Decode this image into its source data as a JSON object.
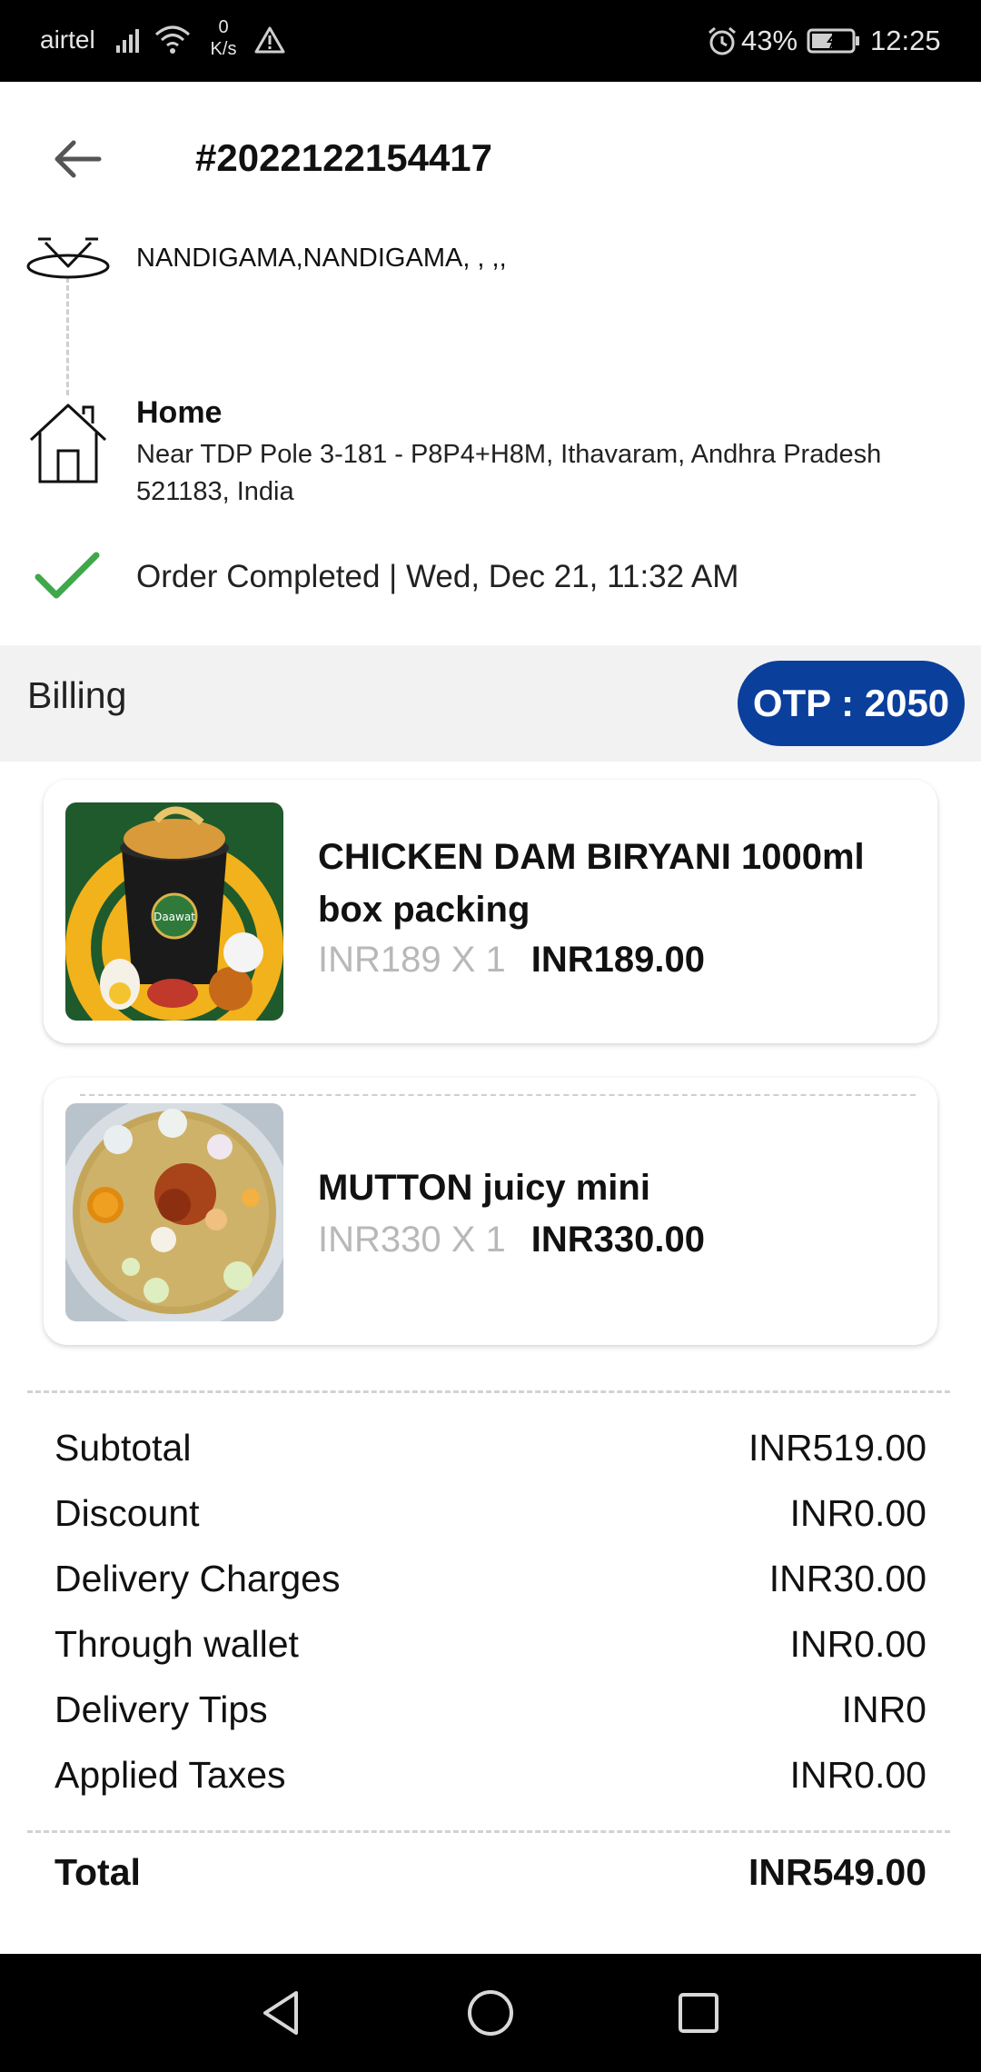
{
  "status_bar": {
    "carrier": "airtel",
    "speed_value": "0",
    "speed_unit": "K/s",
    "battery": "43%",
    "time": "12:25"
  },
  "header": {
    "order_id": "#2022122154417"
  },
  "route": {
    "pickup_address": "NANDIGAMA,NANDIGAMA, , ,,",
    "drop_label": "Home",
    "drop_address": "Near TDP Pole 3-181 - P8P4+H8M, Ithavaram, Andhra Pradesh 521183, India",
    "status": "Order Completed | Wed, Dec 21, 11:32 AM"
  },
  "billing": {
    "title": "Billing",
    "otp": "OTP : 2050"
  },
  "items": [
    {
      "name": "CHICKEN DAM BIRYANI 1000ml box packing",
      "unit": "INR189 X 1",
      "total": "INR189.00",
      "image_brand": "Daawat"
    },
    {
      "name": "MUTTON juicy mini",
      "unit": "INR330 X 1",
      "total": "INR330.00"
    }
  ],
  "summary": {
    "subtotal_label": "Subtotal",
    "subtotal_value": "INR519.00",
    "discount_label": "Discount",
    "discount_value": "INR0.00",
    "delivery_label": "Delivery Charges",
    "delivery_value": "INR30.00",
    "wallet_label": "Through wallet",
    "wallet_value": "INR0.00",
    "tips_label": "Delivery Tips",
    "tips_value": "INR0",
    "taxes_label": "Applied Taxes",
    "taxes_value": "INR0.00",
    "total_label": "Total",
    "total_value": "INR549.00"
  },
  "colors": {
    "accent": "#0a3f9c",
    "check": "#3ea84a",
    "band": "#f2f2f2"
  },
  "icons": [
    "back-arrow-icon",
    "scooter-icon",
    "home-icon",
    "check-icon",
    "nav-back-icon",
    "nav-home-icon",
    "nav-recent-icon"
  ]
}
